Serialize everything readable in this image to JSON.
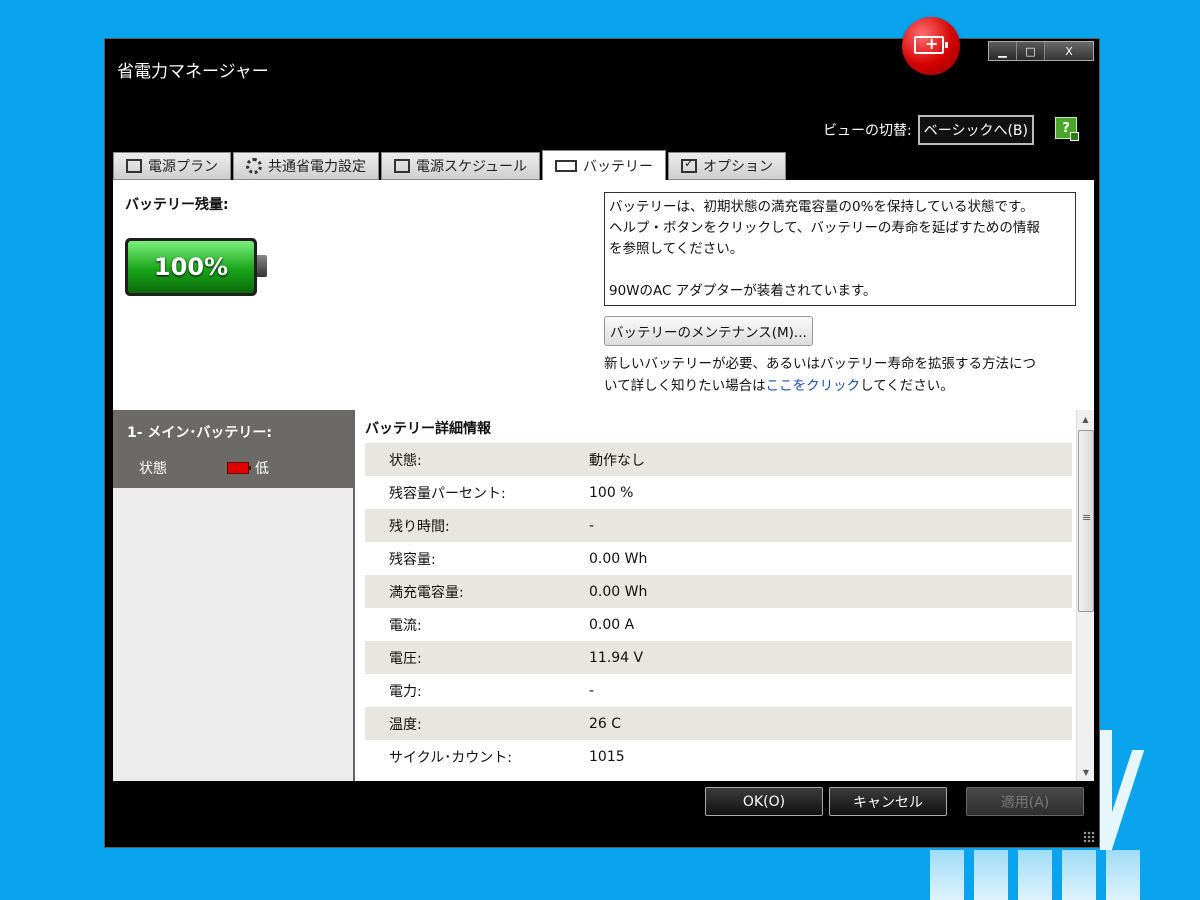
{
  "window": {
    "title": "省電力マネージャー",
    "controls": {
      "minimize": "▁",
      "maximize": "□",
      "close": "X"
    }
  },
  "view_switch": {
    "label": "ビューの切替:",
    "button": "ベーシックへ(B)"
  },
  "help_icon": "?",
  "tabs": [
    {
      "label": "電源プラン",
      "icon": "document-icon"
    },
    {
      "label": "共通省電力設定",
      "icon": "gear-icon"
    },
    {
      "label": "電源スケジュール",
      "icon": "schedule-icon"
    },
    {
      "label": "バッテリー",
      "icon": "battery-icon",
      "active": true
    },
    {
      "label": "オプション",
      "icon": "checkbox-icon"
    }
  ],
  "battery_panel": {
    "remaining_label": "バッテリー残量:",
    "remaining_percent": "100%",
    "info_lines": [
      "バッテリーは、初期状態の満充電容量の0%を保持している状態です。",
      "ヘルプ・ボタンをクリックして、バッテリーの寿命を延ばすための情報",
      "を参照してください。",
      "90WのAC アダプターが装着されています。"
    ],
    "maintenance_button": "バッテリーのメンテナンス(M)...",
    "new_battery_text_1": "新しいバッテリーが必要、あるいはバッテリー寿命を拡張する方法につ",
    "new_battery_text_2": "いて詳しく知りたい場合は",
    "new_battery_link": "ここをクリック",
    "new_battery_text_3": "してください。"
  },
  "battery_list": {
    "name": "1- メイン･バッテリー:",
    "status_label": "状態",
    "status_value": "低"
  },
  "details": {
    "title": "バッテリー詳細情報",
    "rows": [
      {
        "key": "状態:",
        "value": "動作なし"
      },
      {
        "key": "残容量パーセント:",
        "value": "100 %"
      },
      {
        "key": "残り時間:",
        "value": "-"
      },
      {
        "key": "残容量:",
        "value": "0.00 Wh"
      },
      {
        "key": "満充電容量:",
        "value": "0.00 Wh"
      },
      {
        "key": "電流:",
        "value": "0.00 A"
      },
      {
        "key": "電圧:",
        "value": "11.94 V"
      },
      {
        "key": "電力:",
        "value": "-"
      },
      {
        "key": "温度:",
        "value": "26 C"
      },
      {
        "key": "サイクル･カウント:",
        "value": "1015"
      }
    ]
  },
  "footer": {
    "ok": "OK(O)",
    "cancel": "キャンセル",
    "apply": "適用(A)"
  }
}
